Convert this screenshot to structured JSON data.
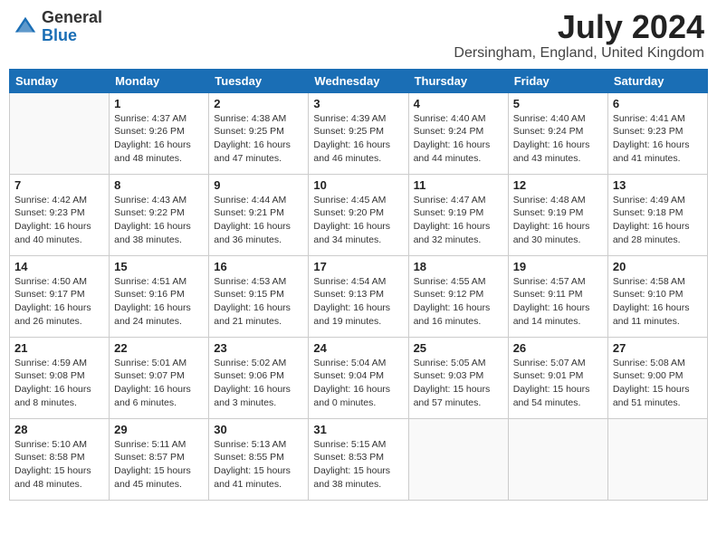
{
  "logo": {
    "general": "General",
    "blue": "Blue"
  },
  "title": {
    "month_year": "July 2024",
    "location": "Dersingham, England, United Kingdom"
  },
  "days_of_week": [
    "Sunday",
    "Monday",
    "Tuesday",
    "Wednesday",
    "Thursday",
    "Friday",
    "Saturday"
  ],
  "weeks": [
    [
      {
        "day": "",
        "info": ""
      },
      {
        "day": "1",
        "info": "Sunrise: 4:37 AM\nSunset: 9:26 PM\nDaylight: 16 hours\nand 48 minutes."
      },
      {
        "day": "2",
        "info": "Sunrise: 4:38 AM\nSunset: 9:25 PM\nDaylight: 16 hours\nand 47 minutes."
      },
      {
        "day": "3",
        "info": "Sunrise: 4:39 AM\nSunset: 9:25 PM\nDaylight: 16 hours\nand 46 minutes."
      },
      {
        "day": "4",
        "info": "Sunrise: 4:40 AM\nSunset: 9:24 PM\nDaylight: 16 hours\nand 44 minutes."
      },
      {
        "day": "5",
        "info": "Sunrise: 4:40 AM\nSunset: 9:24 PM\nDaylight: 16 hours\nand 43 minutes."
      },
      {
        "day": "6",
        "info": "Sunrise: 4:41 AM\nSunset: 9:23 PM\nDaylight: 16 hours\nand 41 minutes."
      }
    ],
    [
      {
        "day": "7",
        "info": "Sunrise: 4:42 AM\nSunset: 9:23 PM\nDaylight: 16 hours\nand 40 minutes."
      },
      {
        "day": "8",
        "info": "Sunrise: 4:43 AM\nSunset: 9:22 PM\nDaylight: 16 hours\nand 38 minutes."
      },
      {
        "day": "9",
        "info": "Sunrise: 4:44 AM\nSunset: 9:21 PM\nDaylight: 16 hours\nand 36 minutes."
      },
      {
        "day": "10",
        "info": "Sunrise: 4:45 AM\nSunset: 9:20 PM\nDaylight: 16 hours\nand 34 minutes."
      },
      {
        "day": "11",
        "info": "Sunrise: 4:47 AM\nSunset: 9:19 PM\nDaylight: 16 hours\nand 32 minutes."
      },
      {
        "day": "12",
        "info": "Sunrise: 4:48 AM\nSunset: 9:19 PM\nDaylight: 16 hours\nand 30 minutes."
      },
      {
        "day": "13",
        "info": "Sunrise: 4:49 AM\nSunset: 9:18 PM\nDaylight: 16 hours\nand 28 minutes."
      }
    ],
    [
      {
        "day": "14",
        "info": "Sunrise: 4:50 AM\nSunset: 9:17 PM\nDaylight: 16 hours\nand 26 minutes."
      },
      {
        "day": "15",
        "info": "Sunrise: 4:51 AM\nSunset: 9:16 PM\nDaylight: 16 hours\nand 24 minutes."
      },
      {
        "day": "16",
        "info": "Sunrise: 4:53 AM\nSunset: 9:15 PM\nDaylight: 16 hours\nand 21 minutes."
      },
      {
        "day": "17",
        "info": "Sunrise: 4:54 AM\nSunset: 9:13 PM\nDaylight: 16 hours\nand 19 minutes."
      },
      {
        "day": "18",
        "info": "Sunrise: 4:55 AM\nSunset: 9:12 PM\nDaylight: 16 hours\nand 16 minutes."
      },
      {
        "day": "19",
        "info": "Sunrise: 4:57 AM\nSunset: 9:11 PM\nDaylight: 16 hours\nand 14 minutes."
      },
      {
        "day": "20",
        "info": "Sunrise: 4:58 AM\nSunset: 9:10 PM\nDaylight: 16 hours\nand 11 minutes."
      }
    ],
    [
      {
        "day": "21",
        "info": "Sunrise: 4:59 AM\nSunset: 9:08 PM\nDaylight: 16 hours\nand 8 minutes."
      },
      {
        "day": "22",
        "info": "Sunrise: 5:01 AM\nSunset: 9:07 PM\nDaylight: 16 hours\nand 6 minutes."
      },
      {
        "day": "23",
        "info": "Sunrise: 5:02 AM\nSunset: 9:06 PM\nDaylight: 16 hours\nand 3 minutes."
      },
      {
        "day": "24",
        "info": "Sunrise: 5:04 AM\nSunset: 9:04 PM\nDaylight: 16 hours\nand 0 minutes."
      },
      {
        "day": "25",
        "info": "Sunrise: 5:05 AM\nSunset: 9:03 PM\nDaylight: 15 hours\nand 57 minutes."
      },
      {
        "day": "26",
        "info": "Sunrise: 5:07 AM\nSunset: 9:01 PM\nDaylight: 15 hours\nand 54 minutes."
      },
      {
        "day": "27",
        "info": "Sunrise: 5:08 AM\nSunset: 9:00 PM\nDaylight: 15 hours\nand 51 minutes."
      }
    ],
    [
      {
        "day": "28",
        "info": "Sunrise: 5:10 AM\nSunset: 8:58 PM\nDaylight: 15 hours\nand 48 minutes."
      },
      {
        "day": "29",
        "info": "Sunrise: 5:11 AM\nSunset: 8:57 PM\nDaylight: 15 hours\nand 45 minutes."
      },
      {
        "day": "30",
        "info": "Sunrise: 5:13 AM\nSunset: 8:55 PM\nDaylight: 15 hours\nand 41 minutes."
      },
      {
        "day": "31",
        "info": "Sunrise: 5:15 AM\nSunset: 8:53 PM\nDaylight: 15 hours\nand 38 minutes."
      },
      {
        "day": "",
        "info": ""
      },
      {
        "day": "",
        "info": ""
      },
      {
        "day": "",
        "info": ""
      }
    ]
  ]
}
